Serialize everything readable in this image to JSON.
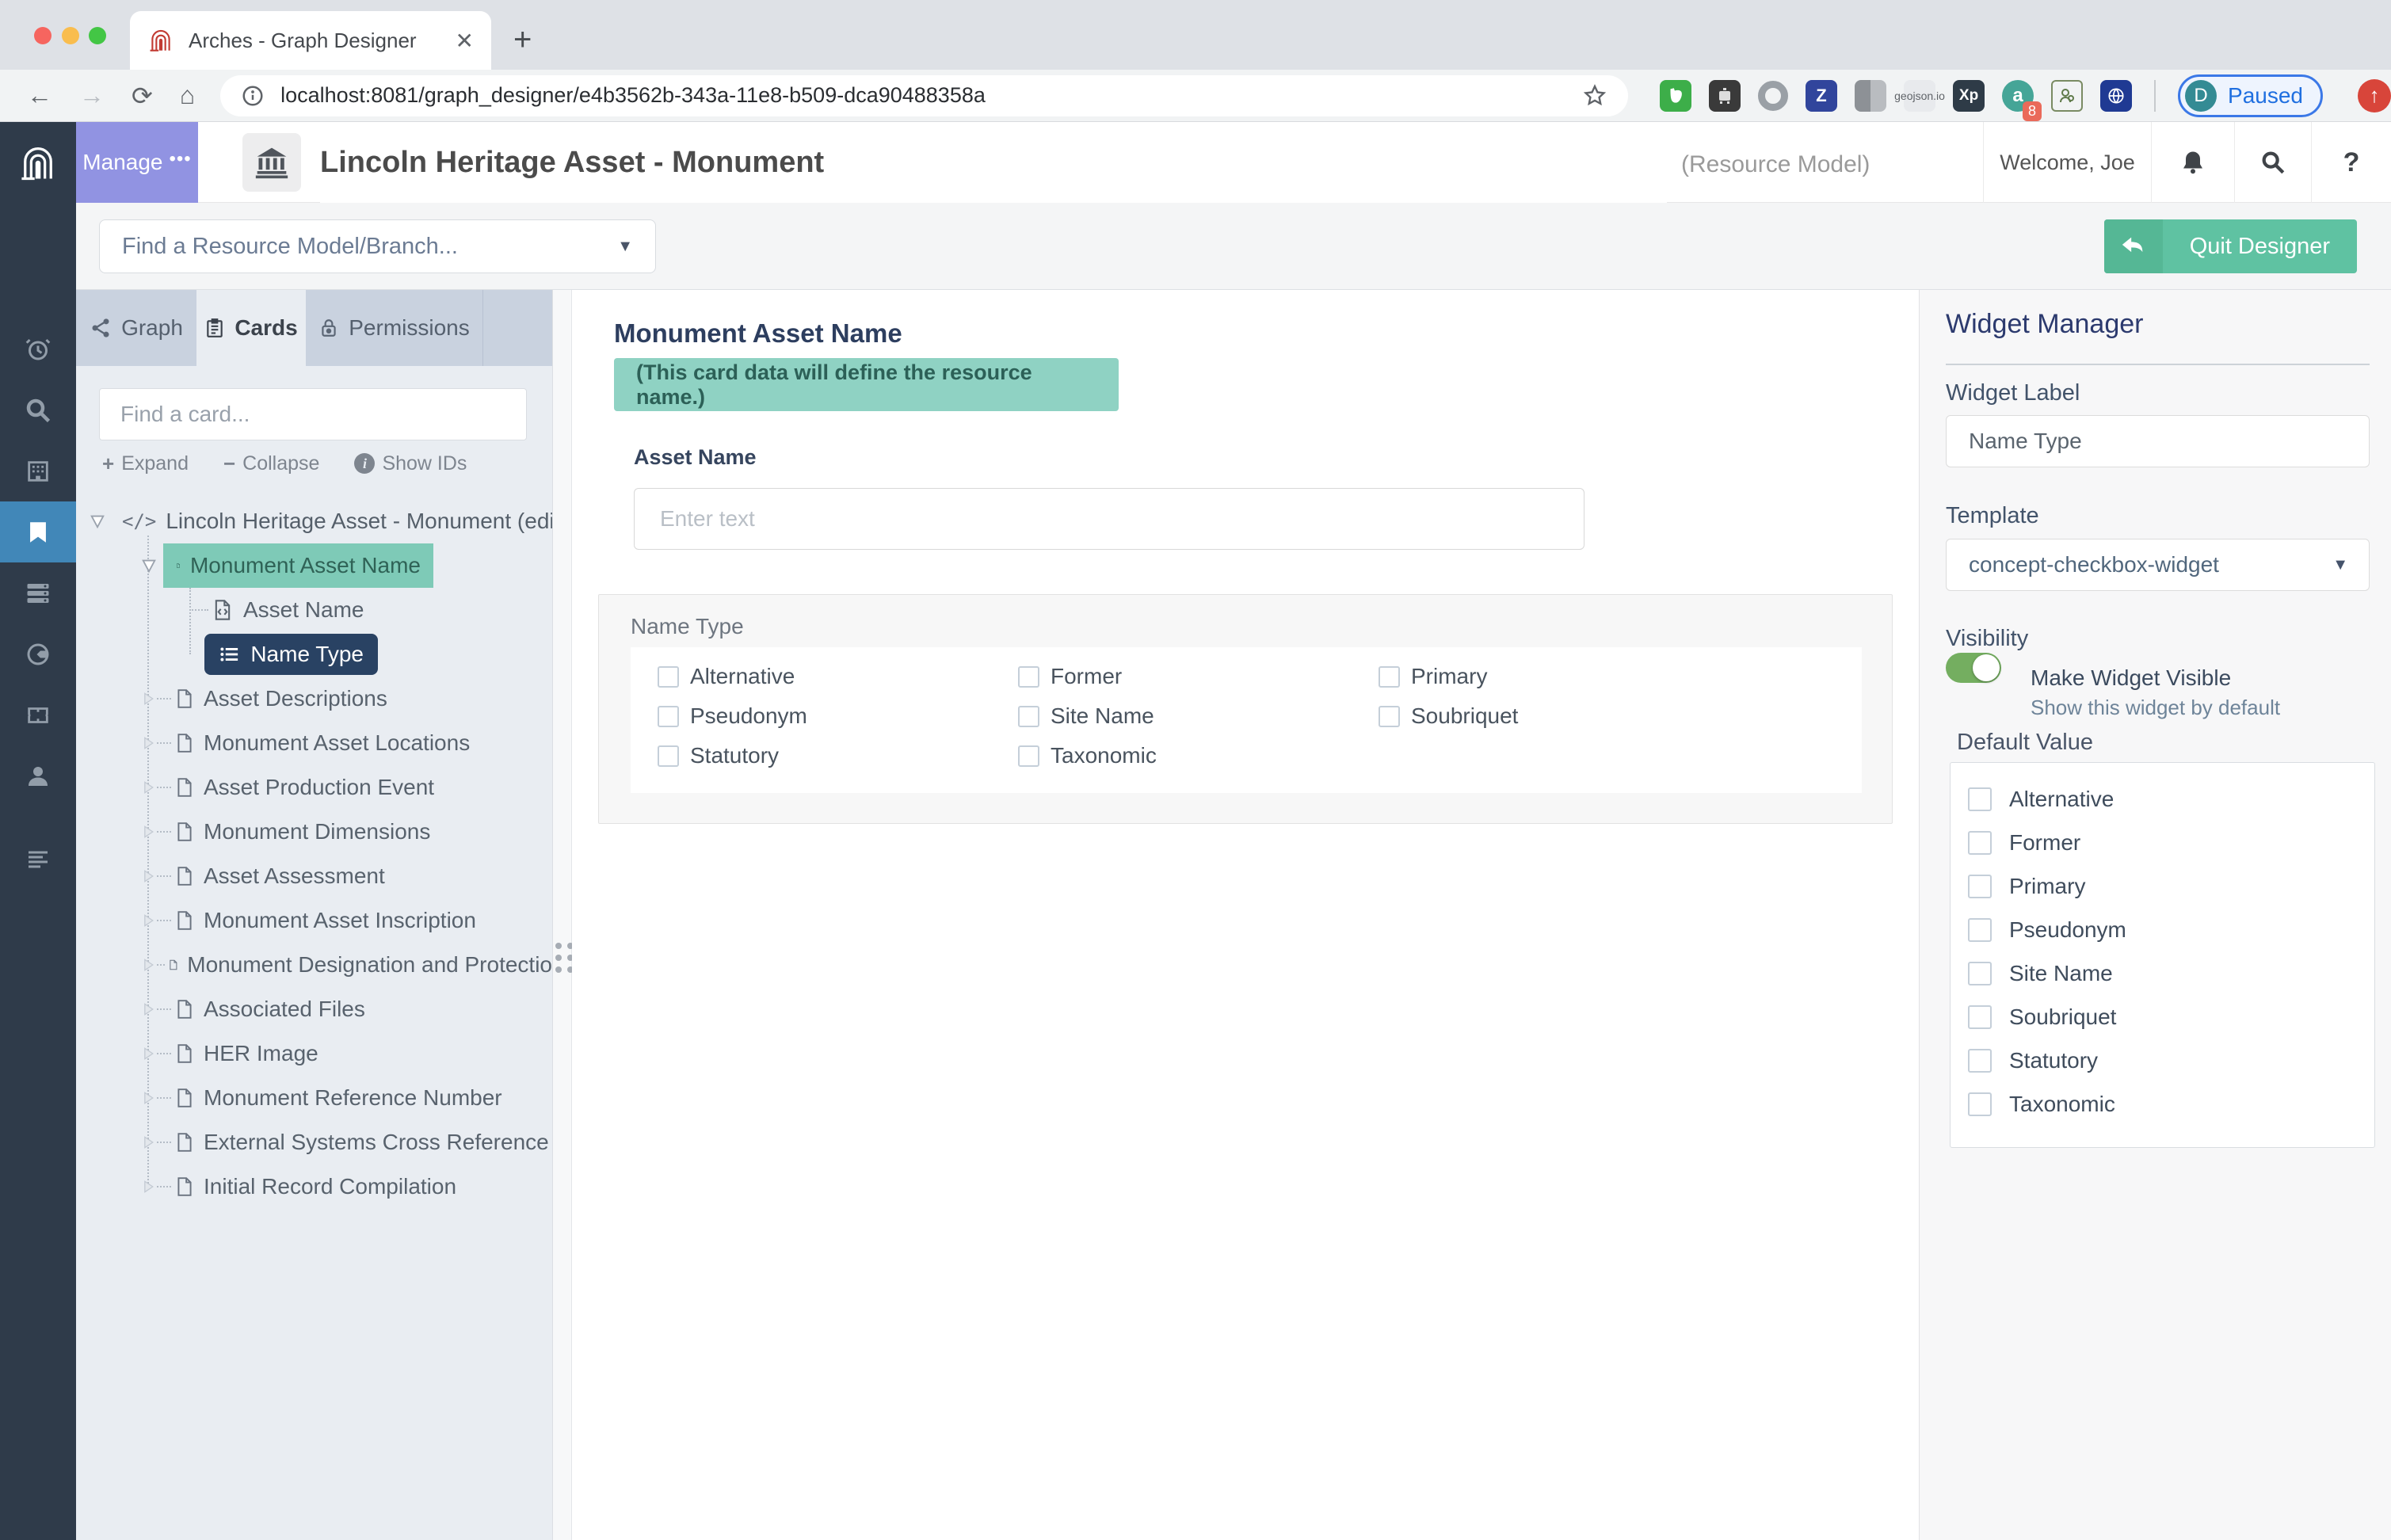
{
  "browser": {
    "tab_title": "Arches - Graph Designer",
    "close_tab": "✕",
    "new_tab": "+",
    "url": "localhost:8081/graph_designer/e4b3562b-343a-11e8-b509-dca90488358a",
    "extensions": {
      "zotero_letter": "Z",
      "geojson_label": "geojson.io",
      "xp_label": "Xp",
      "a_letter": "a",
      "a_badge": "8"
    },
    "profile": {
      "initial": "D",
      "label": "Paused"
    }
  },
  "header": {
    "manage_label": "Manage",
    "manage_dots": "•••",
    "title": "Lincoln Heritage Asset - Monument",
    "subtitle": "(Resource Model)",
    "welcome": "Welcome, Joe",
    "help_label": "?"
  },
  "toolbar": {
    "find_model_placeholder": "Find a Resource Model/Branch...",
    "quit_label": "Quit Designer"
  },
  "left_panel": {
    "tabs": {
      "graph": "Graph",
      "cards": "Cards",
      "permissions": "Permissions"
    },
    "search_placeholder": "Find a card...",
    "actions": {
      "expand": "Expand",
      "collapse": "Collapse",
      "show_ids": "Show IDs"
    },
    "tree": {
      "root_icon": "</>",
      "root": "Lincoln Heritage Asset - Monument (edit r",
      "selected_card": "Monument Asset Name",
      "child_node": "Asset Name",
      "selected_widget": "Name Type",
      "siblings": [
        "Asset Descriptions",
        "Monument Asset Locations",
        "Asset Production Event",
        "Monument Dimensions",
        "Asset Assessment",
        "Monument Asset Inscription",
        "Monument Designation and Protectio",
        "Associated Files",
        "HER Image",
        "Monument Reference Number",
        "External Systems Cross Reference",
        "Initial Record Compilation"
      ]
    }
  },
  "form": {
    "card_title": "Monument Asset Name",
    "note": "(This card data will define the resource name.)",
    "asset_name_label": "Asset Name",
    "asset_name_placeholder": "Enter text",
    "name_type_label": "Name Type",
    "checkbox_options": [
      "Alternative",
      "Former",
      "Primary",
      "Pseudonym",
      "Site Name",
      "Soubriquet",
      "Statutory",
      "Taxonomic"
    ]
  },
  "widget_manager": {
    "title": "Widget Manager",
    "widget_label_label": "Widget Label",
    "widget_label_value": "Name Type",
    "template_label": "Template",
    "template_value": "concept-checkbox-widget",
    "visibility_label": "Visibility",
    "visible_toggle_label": "Make Widget Visible",
    "visible_toggle_sub": "Show this widget by default",
    "default_value_label": "Default Value",
    "default_options": [
      "Alternative",
      "Former",
      "Primary",
      "Pseudonym",
      "Site Name",
      "Soubriquet",
      "Statutory",
      "Taxonomic"
    ]
  },
  "colors": {
    "selected_card_highlight": "#7ecab7",
    "selected_widget_highlight": "#294263",
    "note_badge": "#8fd2c3",
    "quit_button": "#5fc2a2",
    "manage_button": "#9193e2",
    "sidebar_active": "#4187b8",
    "toggle_on": "#74ae60"
  }
}
